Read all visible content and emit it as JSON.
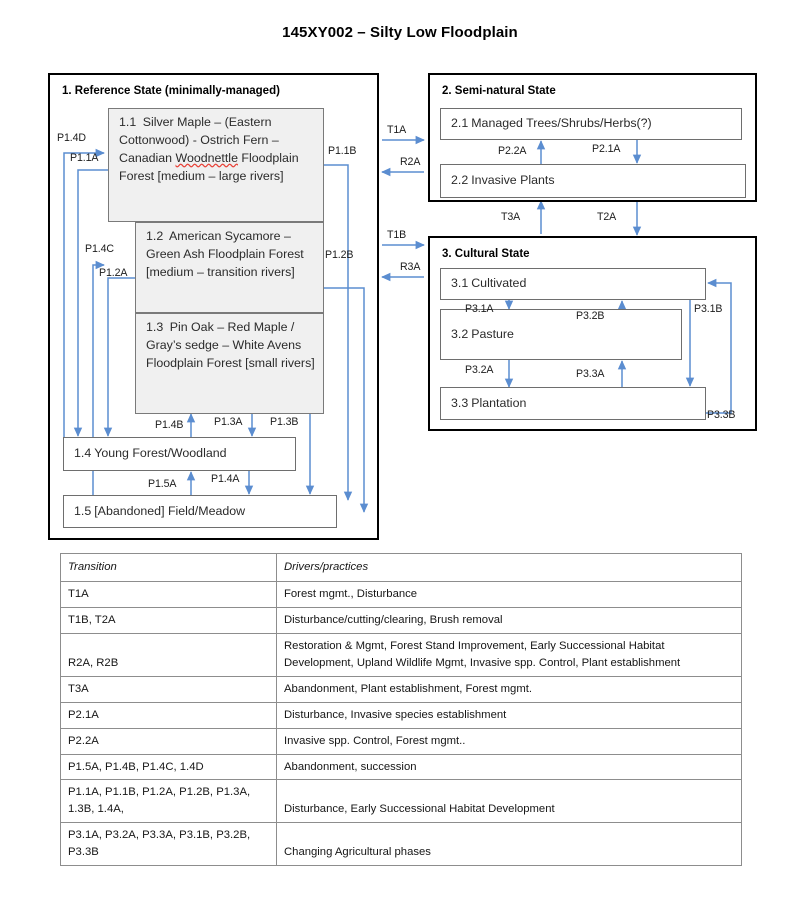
{
  "title": "145XY002 – Silty Low Floodplain",
  "colors": {
    "arrow": "#5b8dd0",
    "box_border": "#6e6e6e",
    "state_border": "#000000",
    "shaded_fill": "#f0f0f0",
    "spellcheck_underline": "#e8443a"
  },
  "diagram": {
    "states": [
      {
        "id": "state-1",
        "title": "1.  Reference State (minimally-managed)",
        "phases": [
          {
            "id": "phase-1-1",
            "num": "1.1",
            "text": "Silver Maple – (Eastern Cottonwood)  - Ostrich Fern – Canadian Woodnettle Floodplain Forest [medium – large rivers]",
            "misspelled": "Woodnettle"
          },
          {
            "id": "phase-1-2",
            "num": "1.2",
            "text": "American Sycamore – Green Ash Floodplain Forest [medium – transition rivers]"
          },
          {
            "id": "phase-1-3",
            "num": "1.3",
            "text": "Pin Oak – Red Maple / Gray’s sedge – White Avens Floodplain Forest [small rivers]"
          },
          {
            "id": "phase-1-4",
            "num": "1.4",
            "text": "Young Forest/Woodland"
          },
          {
            "id": "phase-1-5",
            "num": "1.5",
            "text": "[Abandoned]  Field/Meadow"
          }
        ]
      },
      {
        "id": "state-2",
        "title": "2.  Semi-natural State",
        "phases": [
          {
            "id": "phase-2-1",
            "num": "2.1",
            "text": "Managed Trees/Shrubs/Herbs(?)"
          },
          {
            "id": "phase-2-2",
            "num": "2.2",
            "text": "Invasive Plants"
          }
        ]
      },
      {
        "id": "state-3",
        "title": "3.  Cultural State",
        "phases": [
          {
            "id": "phase-3-1",
            "num": "3.1",
            "text": "Cultivated"
          },
          {
            "id": "phase-3-2",
            "num": "3.2",
            "text": "Pasture"
          },
          {
            "id": "phase-3-3",
            "num": "3.3",
            "text": "Plantation"
          }
        ]
      }
    ],
    "edge_labels": {
      "p1_4d": "P1.4D",
      "p1_1a": "P1.1A",
      "p1_4c": "P1.4C",
      "p1_2a": "P1.2A",
      "p1_1b": "P1.1B",
      "p1_2b": "P1.2B",
      "p1_4b": "P1.4B",
      "p1_3a": "P1.3A",
      "p1_3b": "P1.3B",
      "p1_5a": "P1.5A",
      "p1_4a": "P1.4A",
      "t1a": "T1A",
      "r2a": "R2A",
      "t1b": "T1B",
      "r3a": "R3A",
      "p2_2a": "P2.2A",
      "p2_1a": "P2.1A",
      "t3a": "T3A",
      "t2a": "T2A",
      "p3_1a": "P3.1A",
      "p3_2b": "P3.2B",
      "p3_1b": "P3.1B",
      "p3_2a": "P3.2A",
      "p3_3a": "P3.3A",
      "p3_3b": "P3.3B"
    }
  },
  "table": {
    "headers": [
      "Transition",
      "Drivers/practices"
    ],
    "rows": [
      {
        "transition": "T1A",
        "drivers": "Forest mgmt., Disturbance"
      },
      {
        "transition": "T1B, T2A",
        "drivers": "Disturbance/cutting/clearing, Brush removal"
      },
      {
        "transition": "R2A, R2B",
        "drivers": "Restoration & Mgmt, Forest Stand Improvement, Early Successional Habitat Development, Upland Wildlife Mgmt, Invasive spp. Control, Plant establishment"
      },
      {
        "transition": "T3A",
        "drivers": "Abandonment, Plant establishment, Forest mgmt."
      },
      {
        "transition": "P2.1A",
        "drivers": "Disturbance, Invasive species establishment"
      },
      {
        "transition": "P2.2A",
        "drivers": "Invasive spp. Control, Forest mgmt.."
      },
      {
        "transition": "P1.5A, P1.4B, P1.4C, 1.4D",
        "drivers": "Abandonment,  succession"
      },
      {
        "transition": "P1.1A, P1.1B, P1.2A, P1.2B, P1.3A, 1.3B, 1.4A,",
        "drivers": "Disturbance, Early Successional Habitat Development"
      },
      {
        "transition": "P3.1A, P3.2A, P3.3A, P3.1B, P3.2B, P3.3B",
        "drivers": "Changing Agricultural phases"
      }
    ]
  }
}
